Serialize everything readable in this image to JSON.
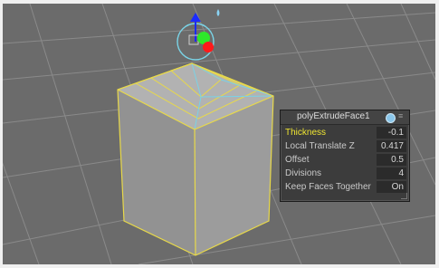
{
  "hud": {
    "title": "polyExtrudeFace1",
    "icon": "visibility-icon",
    "rows": [
      {
        "label": "Thickness",
        "value": "-0.1",
        "highlight": true
      },
      {
        "label": "Local Translate Z",
        "value": "0.417"
      },
      {
        "label": "Offset",
        "value": "0.5"
      },
      {
        "label": "Divisions",
        "value": "4"
      },
      {
        "label": "Keep Faces Together",
        "value": "On"
      }
    ]
  },
  "colors": {
    "viewport_bg": "#6b6b6b",
    "grid": "#8a8a8a",
    "selection": "#e8d94a",
    "component": "#7ad3e6",
    "highlight_label": "#f0e632"
  }
}
